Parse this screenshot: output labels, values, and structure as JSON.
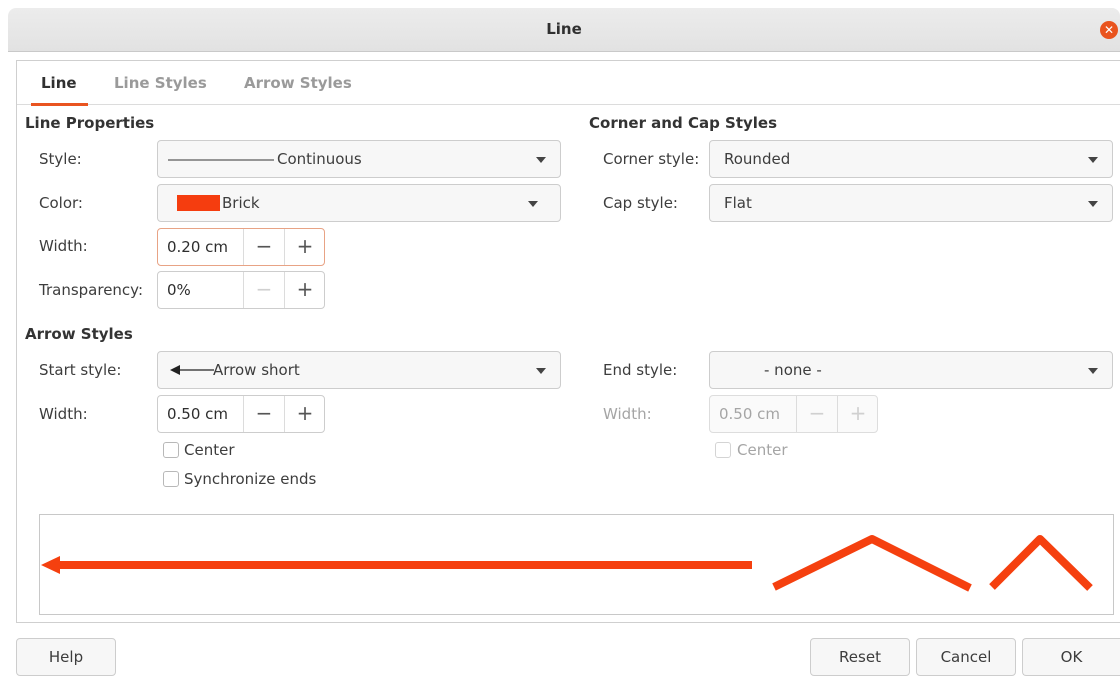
{
  "dialog": {
    "title": "Line",
    "close_icon": "close-icon",
    "accent_color": "#e95420"
  },
  "tabs": [
    {
      "label": "Line",
      "active": true
    },
    {
      "label": "Line Styles",
      "active": false
    },
    {
      "label": "Arrow Styles",
      "active": false
    }
  ],
  "line_properties": {
    "heading": "Line Properties",
    "style": {
      "label": "Style:",
      "value": "Continuous"
    },
    "color": {
      "label": "Color:",
      "value": "Brick",
      "swatch": "#f53d0f"
    },
    "width": {
      "label": "Width:",
      "value": "0.20 cm"
    },
    "transparency": {
      "label": "Transparency:",
      "value": "0%"
    }
  },
  "corner_cap": {
    "heading": "Corner and Cap Styles",
    "corner": {
      "label": "Corner style:",
      "value": "Rounded"
    },
    "cap": {
      "label": "Cap style:",
      "value": "Flat"
    }
  },
  "arrow_styles": {
    "heading": "Arrow Styles",
    "start": {
      "label": "Start style:",
      "value": "Arrow short"
    },
    "start_width": {
      "label": "Width:",
      "value": "0.50 cm"
    },
    "center": {
      "label": "Center",
      "checked": false
    },
    "sync": {
      "label": "Synchronize ends",
      "checked": false
    },
    "end": {
      "label": "End style:",
      "value": "- none -"
    },
    "end_width": {
      "label": "Width:",
      "value": "0.50 cm"
    },
    "end_center": {
      "label": "Center",
      "checked": false
    }
  },
  "spin_labels": {
    "minus": "−",
    "plus": "+"
  },
  "preview": {
    "line_color": "#f5400f"
  },
  "buttons": {
    "help": "Help",
    "reset": "Reset",
    "cancel": "Cancel",
    "ok": "OK"
  }
}
